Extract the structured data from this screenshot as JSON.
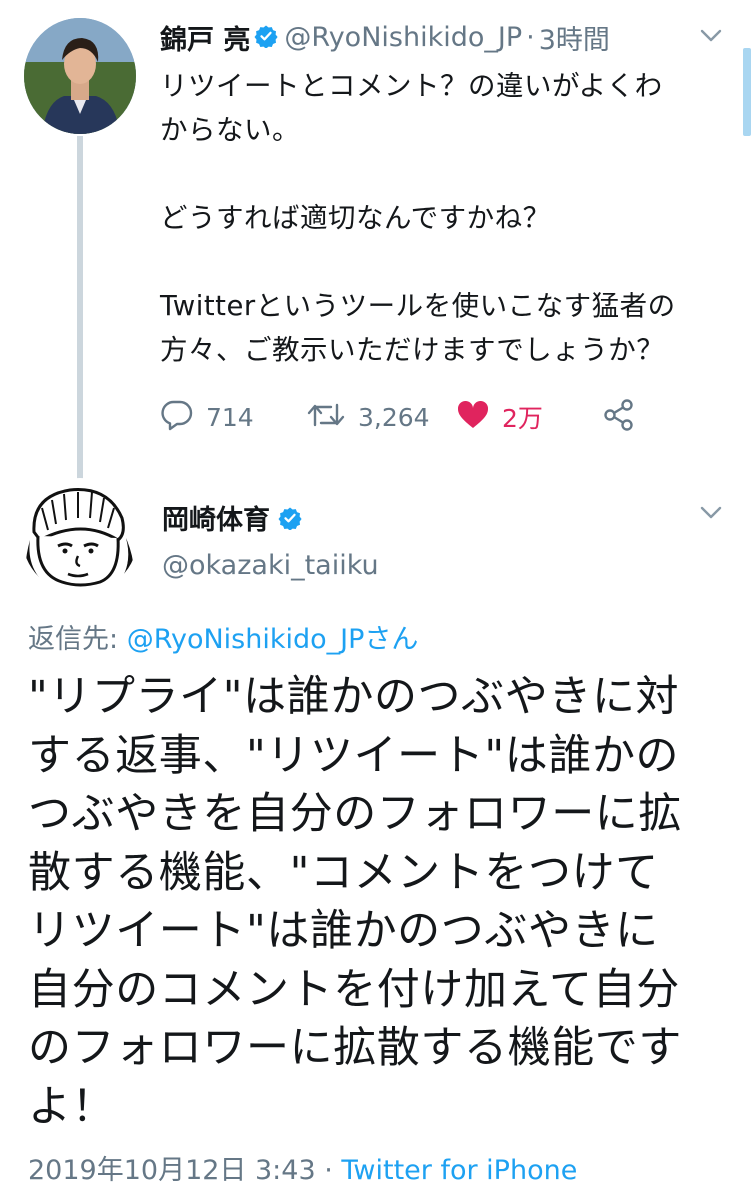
{
  "tweet1": {
    "name": "錦戸 亮",
    "handle": "@RyoNishikido_JP",
    "separator": "·",
    "time": "3時間",
    "text": "リツイートとコメント？の違いがよくわ\nからない。\n\nどうすれば適切なんですかね？\n\nTwitterというツールを使いこなす猛者の\n方々、ご教示いただけますでしょうか？",
    "replies": "714",
    "retweets": "3,264",
    "likes": "2万"
  },
  "tweet2": {
    "name": "岡崎体育",
    "handle": "@okazaki_taiiku",
    "reply_prefix": "返信先: ",
    "reply_mention": "@RyoNishikido_JPさん",
    "text": "\"リプライ\"は誰かのつぶやきに対\nする返事、\"リツイート\"は誰かの\nつぶやきを自分のフォロワーに拡\n散する機能、\"コメントをつけて\nリツイート\"は誰かのつぶやきに\n自分のコメントを付け加えて自分\nのフォロワーに拡散する機能です\nよ！",
    "timestamp": "2019年10月12日 3:43",
    "separator": " · ",
    "source": "Twitter for iPhone"
  },
  "icons": [
    "verified-badge-icon",
    "chevron-down-icon",
    "reply-icon",
    "retweet-icon",
    "heart-icon",
    "share-icon"
  ],
  "colors": {
    "accent": "#1da1f2",
    "like": "#e0245e",
    "secondary": "#657786",
    "thread_line": "#ccd6dd"
  }
}
